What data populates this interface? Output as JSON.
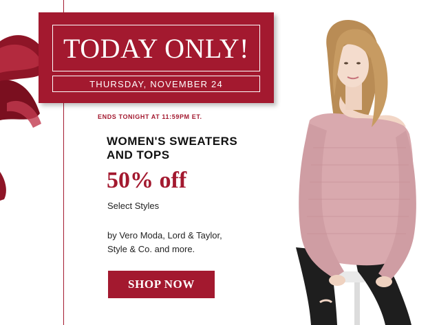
{
  "promo": {
    "title": "TODAY ONLY!",
    "date": "THURSDAY, NOVEMBER 24",
    "ends": "ENDS TONIGHT AT 11:59PM ET."
  },
  "offer": {
    "headline_line1": "WOMEN'S SWEATERS",
    "headline_line2": "AND TOPS",
    "discount": "50% off",
    "subline": "Select Styles",
    "brands_line1": "by Vero Moda, Lord & Taylor,",
    "brands_line2": "Style & Co. and more."
  },
  "cta": {
    "label": "SHOP NOW"
  },
  "colors": {
    "brand": "#a3192f",
    "sweater": "#d9a9ae",
    "pants": "#1e1e1e",
    "hair": "#c79b62"
  },
  "images": {
    "ribbon": "red-satin-ribbon",
    "model": "woman-in-pink-off-shoulder-sweater"
  }
}
